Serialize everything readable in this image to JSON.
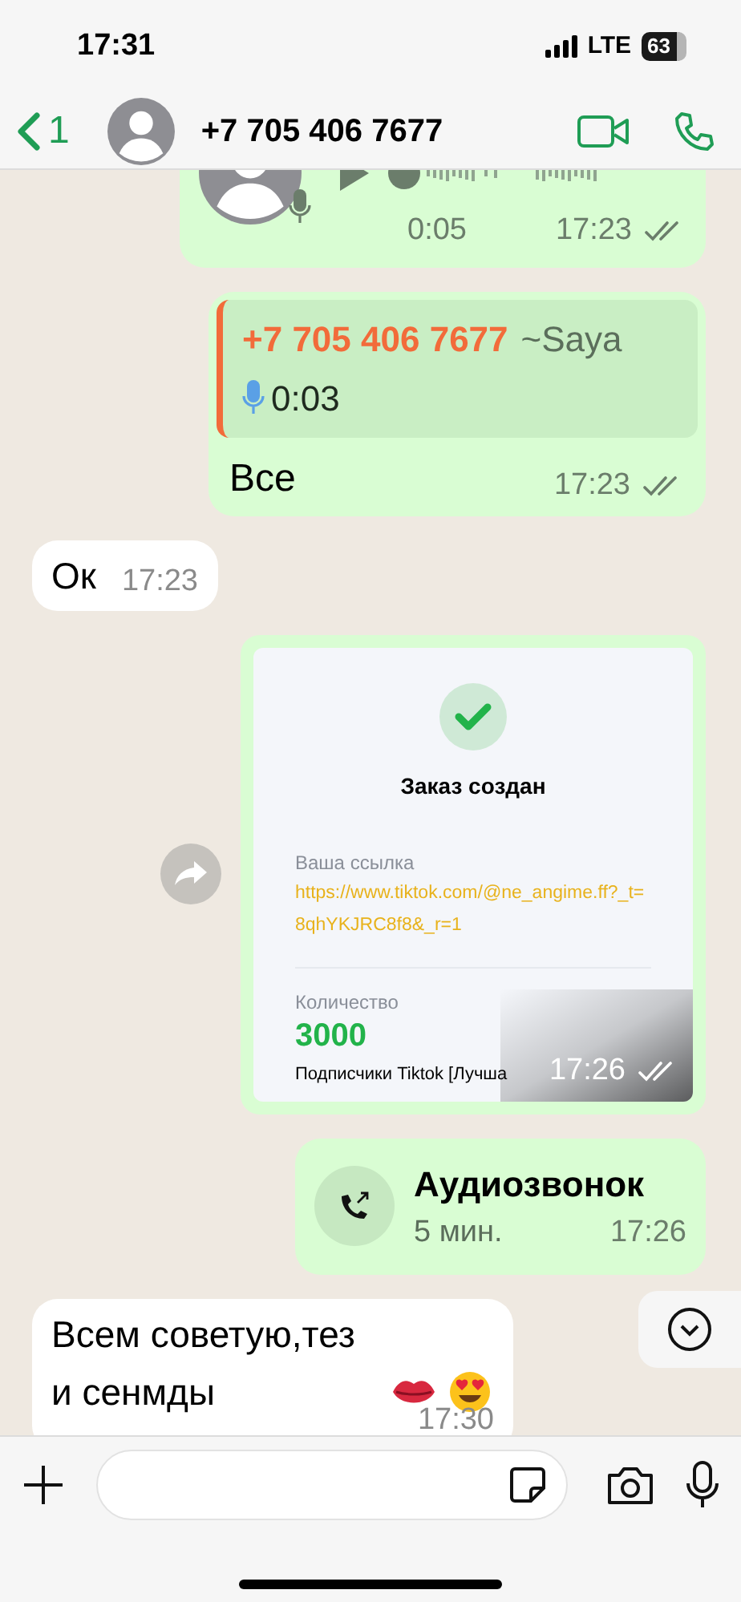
{
  "status_bar": {
    "time": "17:31",
    "network": "LTE",
    "battery": "63"
  },
  "header": {
    "back_count": "1",
    "title": "+7 705 406 7677"
  },
  "messages": [
    {
      "kind": "voice",
      "duration": "0:05",
      "time": "17:23"
    },
    {
      "kind": "reply",
      "quote_sender": "+7 705 406 7677",
      "quote_name": "~Saya",
      "quote_duration": "0:03",
      "text": "Все",
      "time": "17:23"
    },
    {
      "kind": "text",
      "text": "Ок",
      "time": "17:23"
    },
    {
      "kind": "image",
      "time": "17:26",
      "shot": {
        "title": "Заказ создан",
        "link_label": "Ваша ссылка",
        "link": "https://www.tiktok.com/@ne_angime.ff?_t=8qhYKJRC8f8&_r=1",
        "qty_label": "Количество",
        "qty": "3000",
        "product": "Подписчики Tiktok [Лучша"
      }
    },
    {
      "kind": "call",
      "title": "Аудиозвонок",
      "duration": "5 мин.",
      "time": "17:26"
    },
    {
      "kind": "text_emoji",
      "text": "Всем советую,тез и сенмды",
      "time": "17:30"
    }
  ]
}
